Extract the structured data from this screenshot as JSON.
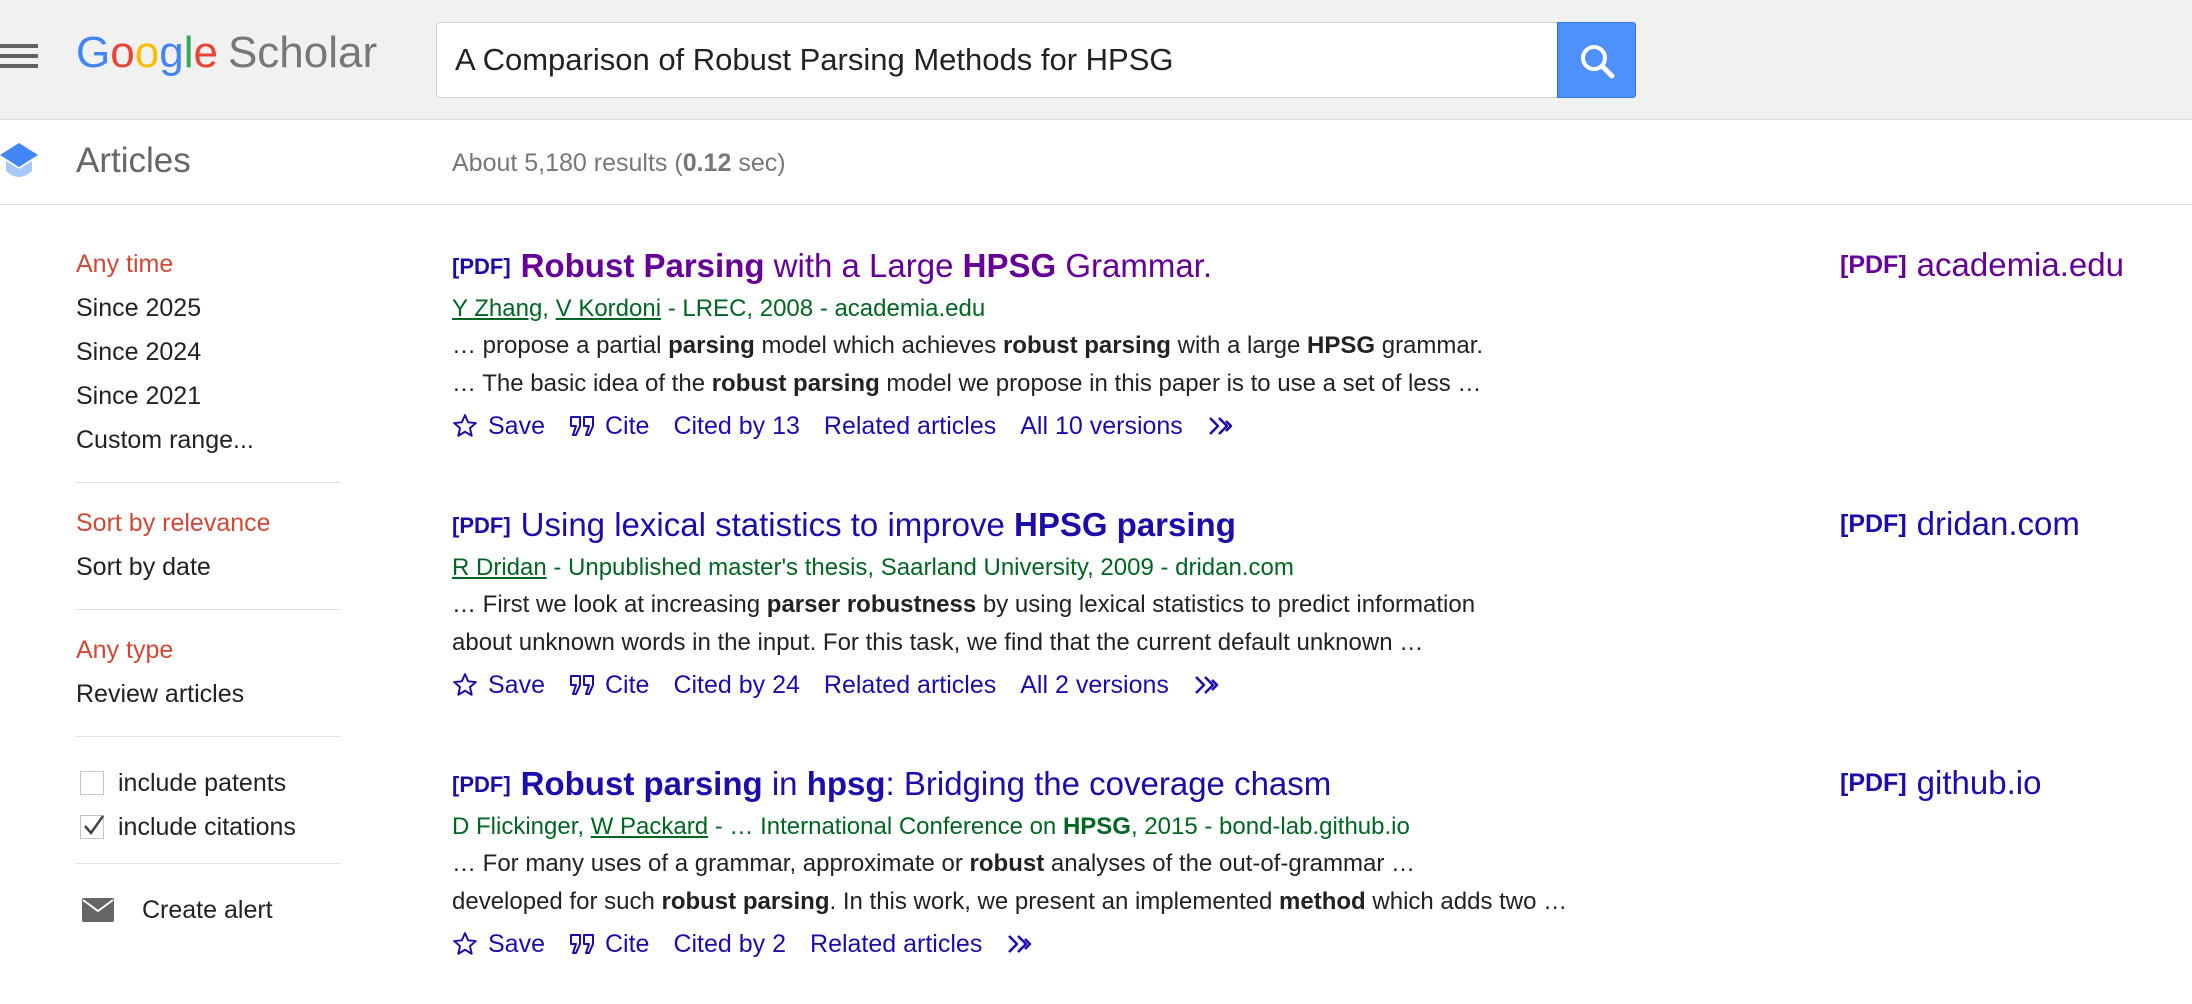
{
  "header": {
    "logo_google": "Google",
    "logo_scholar": "Scholar",
    "search_value": "A Comparison of Robust Parsing Methods for HPSG"
  },
  "subheader": {
    "section_label": "Articles",
    "results_prefix": "About 5,180 results (",
    "results_time": "0.12",
    "results_suffix": " sec)"
  },
  "sidebar": {
    "time_filters": [
      "Any time",
      "Since 2025",
      "Since 2024",
      "Since 2021",
      "Custom range..."
    ],
    "sort_options": [
      "Sort by relevance",
      "Sort by date"
    ],
    "type_filters": [
      "Any type",
      "Review articles"
    ],
    "include_patents": "include patents",
    "include_citations": "include citations",
    "create_alert": "Create alert"
  },
  "results": [
    {
      "pdf_tag": "[PDF]",
      "title_parts": [
        [
          "Robust Parsing",
          true
        ],
        [
          " with a Large ",
          false
        ],
        [
          "HPSG",
          true
        ],
        [
          " Grammar.",
          false
        ]
      ],
      "authors": [
        [
          "Y Zhang",
          true
        ],
        [
          ", ",
          false
        ],
        [
          "V Kordoni",
          true
        ],
        [
          " - LREC, 2008 - academia.edu",
          false
        ]
      ],
      "snippet1": [
        [
          "… propose a partial ",
          false
        ],
        [
          "parsing",
          true
        ],
        [
          " model which achieves ",
          false
        ],
        [
          "robust parsing",
          true
        ],
        [
          " with a large ",
          false
        ],
        [
          "HPSG",
          true
        ],
        [
          " grammar.",
          false
        ]
      ],
      "snippet2": [
        [
          "… The basic idea of the ",
          false
        ],
        [
          "robust parsing",
          true
        ],
        [
          " model we propose in this paper is to use a set of less …",
          false
        ]
      ],
      "save": "Save",
      "cite": "Cite",
      "cited_by": "Cited by 13",
      "related": "Related articles",
      "versions": "All 10 versions",
      "side_tag": "[PDF]",
      "side_domain": "academia.edu"
    },
    {
      "pdf_tag": "[PDF]",
      "title_parts": [
        [
          "Using lexical statistics to improve ",
          false
        ],
        [
          "HPSG parsing",
          true
        ]
      ],
      "authors": [
        [
          "R Dridan",
          true
        ],
        [
          " - Unpublished master's thesis, Saarland University, 2009 - dridan.com",
          false
        ]
      ],
      "snippet1": [
        [
          "… First we look at increasing ",
          false
        ],
        [
          "parser robustness",
          true
        ],
        [
          " by using lexical statistics to predict information",
          false
        ]
      ],
      "snippet2": [
        [
          "about unknown words in the input. For this task, we find that the current default unknown …",
          false
        ]
      ],
      "save": "Save",
      "cite": "Cite",
      "cited_by": "Cited by 24",
      "related": "Related articles",
      "versions": "All 2 versions",
      "side_tag": "[PDF]",
      "side_domain": "dridan.com"
    },
    {
      "pdf_tag": "[PDF]",
      "title_parts": [
        [
          "Robust parsing",
          true
        ],
        [
          " in ",
          false
        ],
        [
          "hpsg",
          true
        ],
        [
          ": Bridging the coverage chasm",
          false
        ]
      ],
      "authors": [
        [
          "D Flickinger, ",
          false
        ],
        [
          "W Packard",
          true
        ],
        [
          " - … International Conference on ",
          false
        ],
        [
          "HPSG",
          "b"
        ],
        [
          ", 2015 - bond-lab.github.io",
          false
        ]
      ],
      "snippet1": [
        [
          "… For many uses of a grammar, approximate or ",
          false
        ],
        [
          "robust",
          true
        ],
        [
          " analyses of the out-of-grammar …",
          false
        ]
      ],
      "snippet2": [
        [
          "developed for such ",
          false
        ],
        [
          "robust parsing",
          true
        ],
        [
          ". In this work, we present an implemented ",
          false
        ],
        [
          "method",
          true
        ],
        [
          " which adds two …",
          false
        ]
      ],
      "save": "Save",
      "cite": "Cite",
      "cited_by": "Cited by 2",
      "related": "Related articles",
      "versions": "",
      "side_tag": "[PDF]",
      "side_domain": "github.io"
    }
  ],
  "colors": {
    "link": "#1a0dab",
    "visited": "#660099",
    "meta_green": "#006621",
    "active_filter": "#d14836",
    "search_button": "#4d90fe"
  }
}
